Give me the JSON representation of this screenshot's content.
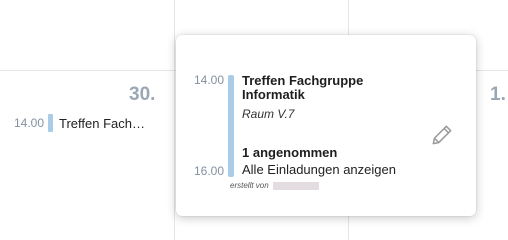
{
  "calendar": {
    "days": [
      {
        "number": "30."
      },
      {
        "number": "1."
      }
    ],
    "event": {
      "time": "14.00",
      "title": "Treffen Fachgruppe Informatik"
    }
  },
  "popover": {
    "start_time": "14.00",
    "end_time": "16.00",
    "title": "Treffen Fachgruppe Informatik",
    "room": "Raum V.7",
    "accepted": "1 angenommen",
    "show_invites_link": "Alle Einladungen anzeigen",
    "created_by_label": "erstellt von",
    "edit_icon": "pencil-icon"
  },
  "colors": {
    "event_bar": "#a9cde9",
    "day_number": "#9aa7b4",
    "time_text": "#8391a0"
  }
}
